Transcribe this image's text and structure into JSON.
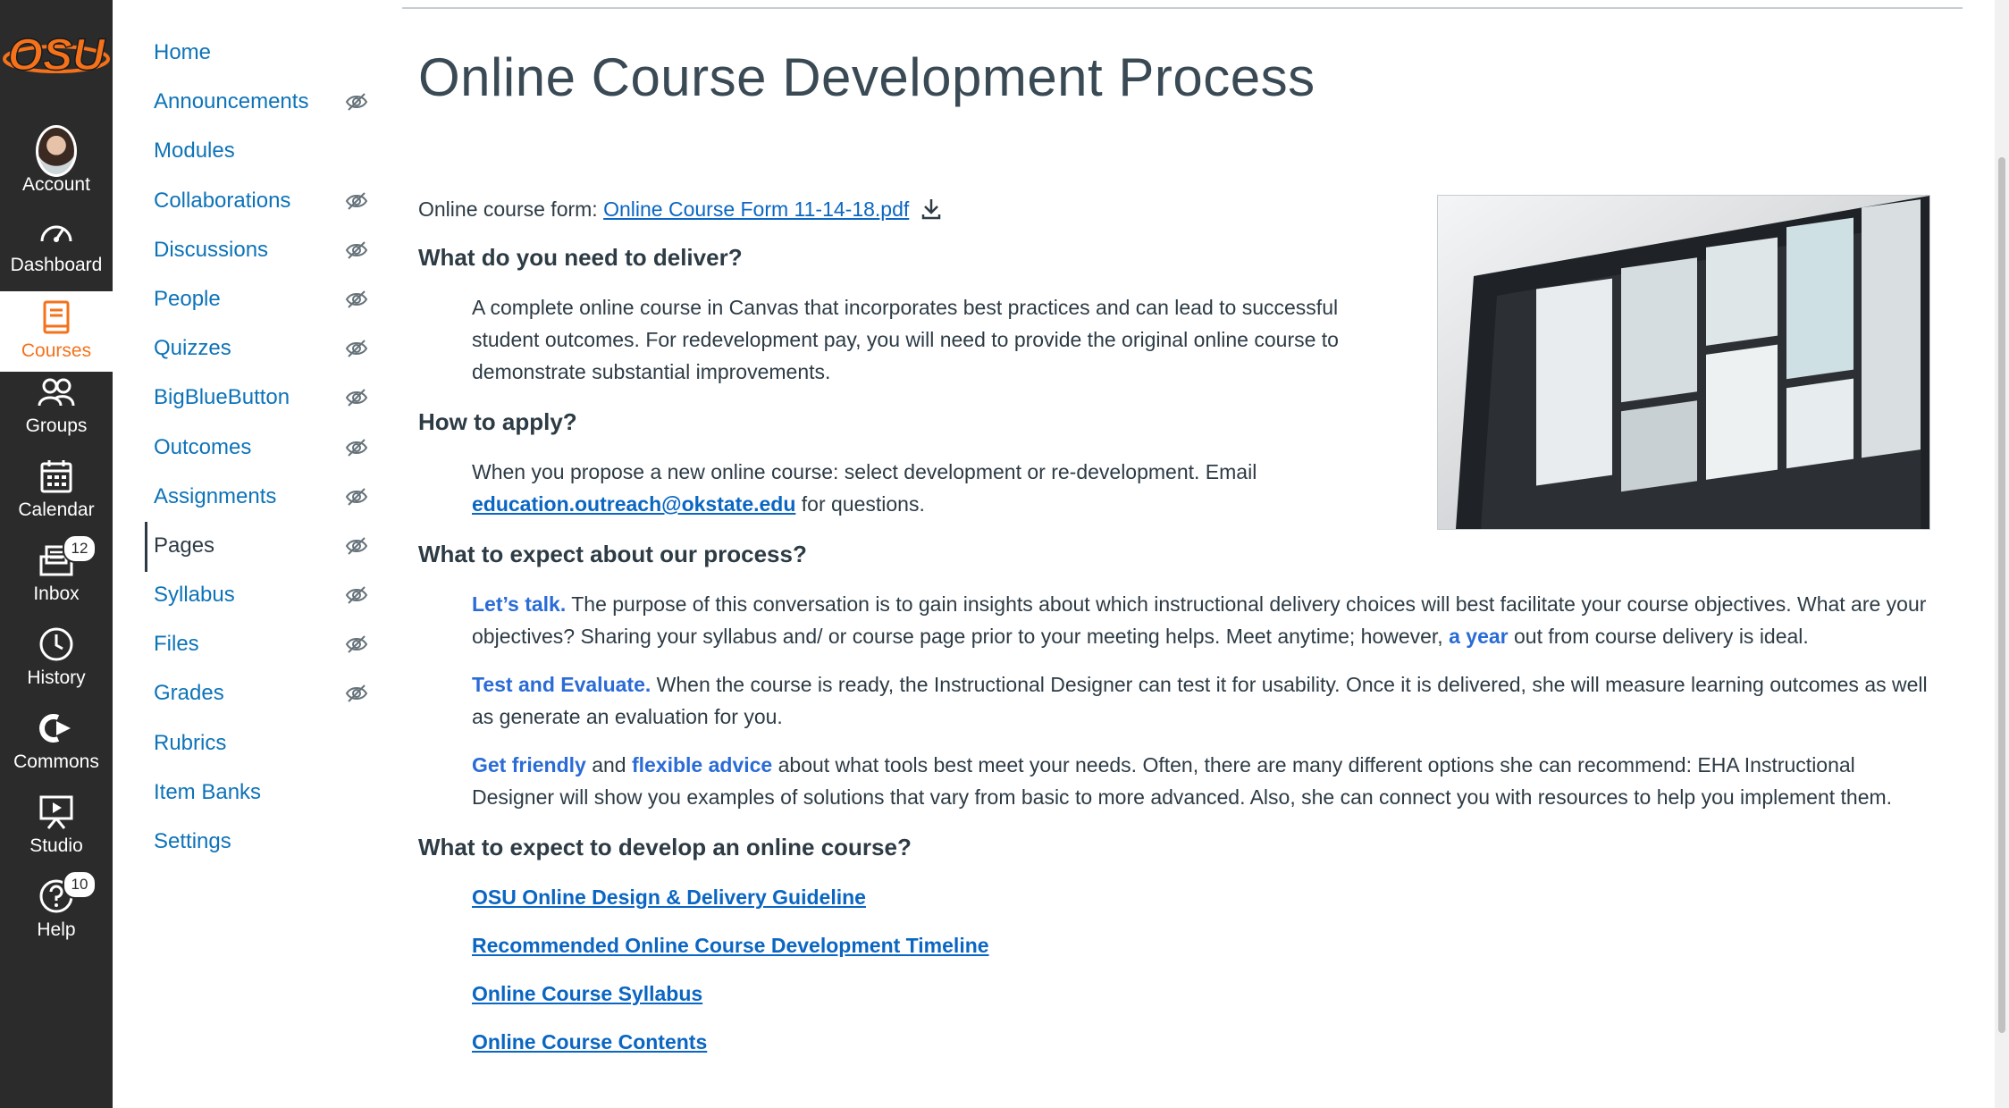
{
  "global_nav": {
    "logo_text": "OSU",
    "items": [
      {
        "label": "Account",
        "icon": "avatar"
      },
      {
        "label": "Dashboard",
        "icon": "dashboard-icon"
      },
      {
        "label": "Courses",
        "icon": "book-icon"
      },
      {
        "label": "Groups",
        "icon": "groups-icon"
      },
      {
        "label": "Calendar",
        "icon": "calendar-icon"
      },
      {
        "label": "Inbox",
        "icon": "inbox-icon",
        "badge": "12"
      },
      {
        "label": "History",
        "icon": "clock-icon"
      },
      {
        "label": "Commons",
        "icon": "commons-icon"
      },
      {
        "label": "Studio",
        "icon": "studio-icon"
      },
      {
        "label": "Help",
        "icon": "help-icon",
        "badge": "10"
      }
    ],
    "active": "Courses",
    "active_color": "#f5721b"
  },
  "course_nav": {
    "items": [
      {
        "label": "Home",
        "hidden": false
      },
      {
        "label": "Announcements",
        "hidden": true
      },
      {
        "label": "Modules",
        "hidden": false
      },
      {
        "label": "Collaborations",
        "hidden": true
      },
      {
        "label": "Discussions",
        "hidden": true
      },
      {
        "label": "People",
        "hidden": true
      },
      {
        "label": "Quizzes",
        "hidden": true
      },
      {
        "label": "BigBlueButton",
        "hidden": true
      },
      {
        "label": "Outcomes",
        "hidden": true
      },
      {
        "label": "Assignments",
        "hidden": true
      },
      {
        "label": "Pages",
        "hidden": true
      },
      {
        "label": "Syllabus",
        "hidden": true
      },
      {
        "label": "Files",
        "hidden": true
      },
      {
        "label": "Grades",
        "hidden": true
      },
      {
        "label": "Rubrics",
        "hidden": false
      },
      {
        "label": "Item Banks",
        "hidden": false
      },
      {
        "label": "Settings",
        "hidden": false
      }
    ],
    "active": "Pages"
  },
  "page": {
    "title": "Online Course Development Process",
    "form_label": "Online course form:",
    "form_link": "Online Course Form 11-14-18.pdf",
    "h_deliver": "What do you need to deliver?",
    "p_deliver": "A complete online course in Canvas that incorporates best practices and can lead to successful student outcomes. For redevelopment pay, you will need to provide the original online course to demonstrate substantial improvements.",
    "h_apply": "How to apply?",
    "p_apply_1": "When you propose a new online course: select development or re-development. Email",
    "p_apply_email": "education.outreach@okstate.edu",
    "p_apply_2": "for questions.",
    "h_process": "What to expect about our process?",
    "talk_label": "Let’s talk.",
    "talk_text_1": "The purpose of this conversation is to gain insights about which instructional delivery choices will best facilitate your course objectives. What are your objectives? Sharing your syllabus and/ or course page prior to your meeting helps. Meet anytime; however,",
    "talk_year": "a year",
    "talk_text_2": "out from course delivery is ideal.",
    "test_label": "Test and Evaluate.",
    "test_text": "When the course is ready, the Instructional Designer can test it for usability. Once it is delivered, she will measure learning outcomes as well as generate an evaluation for you.",
    "friendly_label": "Get friendly",
    "friendly_and": "and",
    "advice_label": "flexible advice",
    "advice_text": "about what tools best meet your needs. Often, there are many different options she can recommend: EHA Instructional Designer will show you examples of solutions that vary from basic to more advanced. Also, she can connect you with resources to help you implement them.",
    "h_develop": "What to expect to develop an online course?",
    "links": [
      "OSU Online Design & Delivery Guideline",
      "Recommended Online Course Development Timeline",
      "Online Course Syllabus ",
      "Online Course Contents"
    ]
  }
}
